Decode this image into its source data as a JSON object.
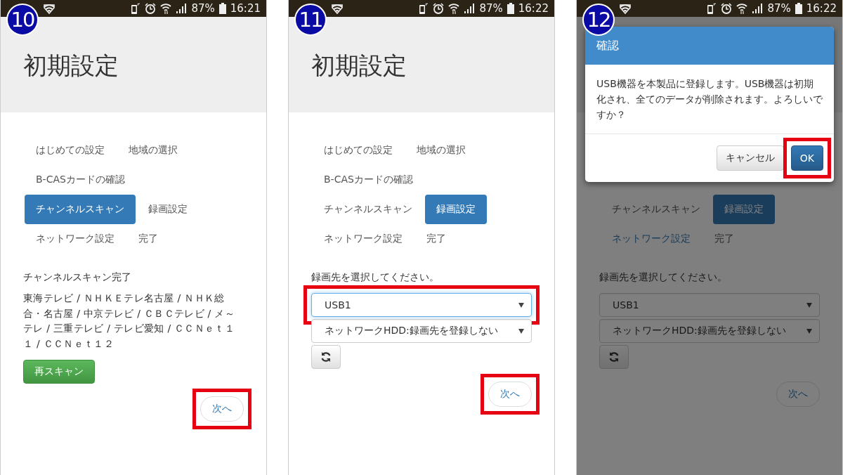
{
  "screens": [
    {
      "badge": "10",
      "status_bar": {
        "battery": "87%",
        "time": "16:21"
      },
      "title": "初期設定",
      "steps": [
        [
          {
            "label": "はじめての設定",
            "selected": false,
            "highlighted": false
          },
          {
            "label": "地域の選択",
            "selected": false,
            "highlighted": false
          }
        ],
        [
          {
            "label": "B-CASカードの確認",
            "selected": false,
            "highlighted": false
          }
        ],
        [
          {
            "label": "チャンネルスキャン",
            "selected": true,
            "highlighted": false
          },
          {
            "label": "録画設定",
            "selected": false,
            "highlighted": false
          }
        ],
        [
          {
            "label": "ネットワーク設定",
            "selected": false,
            "highlighted": false
          },
          {
            "label": "完了",
            "selected": false,
            "highlighted": false
          }
        ]
      ],
      "content": {
        "kind": "scan",
        "heading": "チャンネルスキャン完了",
        "channels": "東海テレビ / ＮＨＫＥテレ名古屋 / ＮＨＫ総合・名古屋 / 中京テレビ / ＣＢＣテレビ / メ～テレ / 三重テレビ / テレビ愛知 / ＣＣＮｅｔ１１ / ＣＣＮｅｔ１２",
        "rescan_button": "再スキャン"
      },
      "next_button": {
        "label": "次へ",
        "annotated": true
      }
    },
    {
      "badge": "11",
      "status_bar": {
        "battery": "87%",
        "time": "16:22"
      },
      "title": "初期設定",
      "steps": [
        [
          {
            "label": "はじめての設定",
            "selected": false,
            "highlighted": false
          },
          {
            "label": "地域の選択",
            "selected": false,
            "highlighted": false
          }
        ],
        [
          {
            "label": "B-CASカードの確認",
            "selected": false,
            "highlighted": false
          }
        ],
        [
          {
            "label": "チャンネルスキャン",
            "selected": false,
            "highlighted": false
          },
          {
            "label": "録画設定",
            "selected": true,
            "highlighted": false
          }
        ],
        [
          {
            "label": "ネットワーク設定",
            "selected": false,
            "highlighted": false
          },
          {
            "label": "完了",
            "selected": false,
            "highlighted": false
          }
        ]
      ],
      "content": {
        "kind": "record",
        "prompt": "録画先を選択してください。",
        "selects": [
          {
            "value": "USB1",
            "focused": true,
            "annotated": true
          },
          {
            "value": "ネットワークHDD:録画先を登録しない",
            "focused": false,
            "annotated": false
          }
        ]
      },
      "next_button": {
        "label": "次へ",
        "annotated": true
      }
    },
    {
      "badge": "12",
      "status_bar": {
        "battery": "87%",
        "time": "16:22"
      },
      "steps": [
        [
          {
            "label": "チャンネルスキャン",
            "selected": false,
            "highlighted": false
          },
          {
            "label": "録画設定",
            "selected": true,
            "highlighted": false
          }
        ],
        [
          {
            "label": "ネットワーク設定",
            "selected": false,
            "highlighted": true
          },
          {
            "label": "完了",
            "selected": false,
            "highlighted": false
          }
        ]
      ],
      "content": {
        "kind": "record",
        "prompt": "録画先を選択してください。",
        "selects": [
          {
            "value": "USB1",
            "focused": false,
            "annotated": false
          },
          {
            "value": "ネットワークHDD:録画先を登録しない",
            "focused": false,
            "annotated": false
          }
        ]
      },
      "next_button": {
        "label": "次へ",
        "annotated": false
      },
      "dialog": {
        "title": "確認",
        "message": "USB機器を本製品に登録します。USB機器は初期化され、全てのデータが削除されます。よろしいですか？",
        "buttons": [
          {
            "label": "キャンセル",
            "kind": "default",
            "annotated": false
          },
          {
            "label": "OK",
            "kind": "primary",
            "annotated": true
          }
        ]
      }
    }
  ]
}
